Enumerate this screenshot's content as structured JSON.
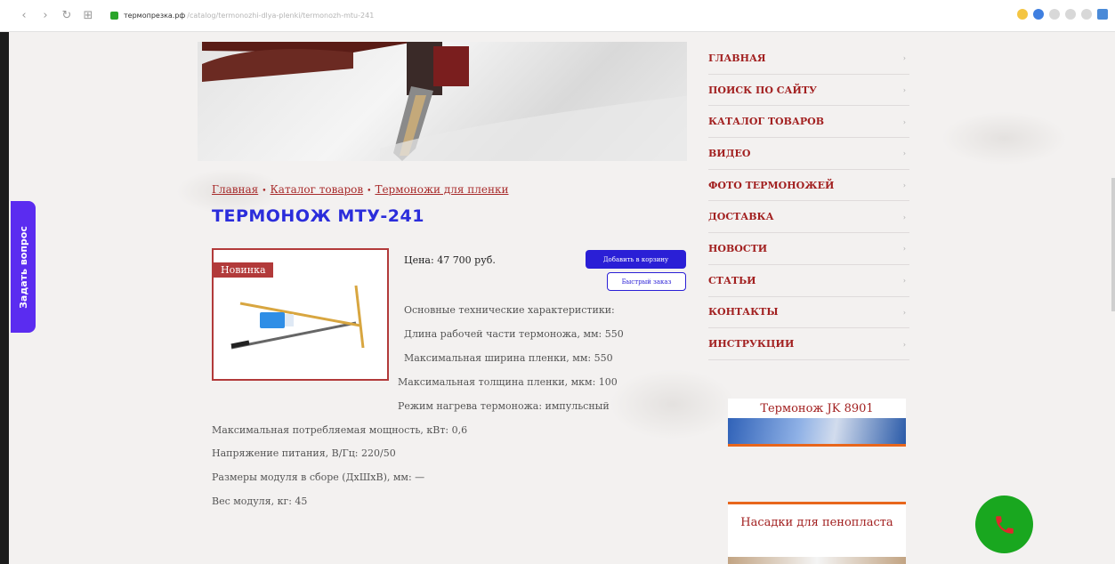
{
  "browser": {
    "domain": "термопрезка.рф",
    "path": "/catalog/termonozhi-dlya-plenki/termonozh-mtu-241"
  },
  "ask_tab": {
    "label": "Задать вопрос"
  },
  "breadcrumb": {
    "items": [
      "Главная",
      "Каталог товаров",
      "Термоножи для пленки"
    ],
    "separator": "•"
  },
  "product": {
    "title": "ТЕРМОНОЖ МТУ-241",
    "badge": "Новинка",
    "price": "Цена: 47 700 руб.",
    "add_to_cart": "Добавить в корзину",
    "quick_order": "Быстрый заказ",
    "specs": [
      "Основные технические характеристики:",
      "Длина рабочей части термоножа, мм: 550",
      "Максимальная ширина пленки, мм: 550",
      "Максимальная толщина пленки, мкм: 100",
      "Режим нагрева термоножа: импульсный",
      "Максимальная потребляемая мощность, кВт: 0,6",
      "Напряжение питания, В/Гц: 220/50",
      "Размеры модуля в сборе (ДхШхВ), мм: —",
      "Вес модуля, кг: 45"
    ]
  },
  "menu": {
    "items": [
      "ГЛАВНАЯ",
      "ПОИСК ПО САЙТУ",
      "КАТАЛОГ ТОВАРОВ",
      "ВИДЕО",
      "ФОТО ТЕРМОНОЖЕЙ",
      "ДОСТАВКА",
      "НОВОСТИ",
      "СТАТЬИ",
      "КОНТАКТЫ",
      "ИНСТРУКЦИИ"
    ]
  },
  "side_banners": {
    "banner1_title": "Термонож JK 8901",
    "banner2_title": "Насадки для пенопласта"
  },
  "colors": {
    "accent_red": "#a22020",
    "accent_blue": "#2b2ddb",
    "call_green": "#19a71f",
    "ask_purple": "#5b2cf0"
  }
}
